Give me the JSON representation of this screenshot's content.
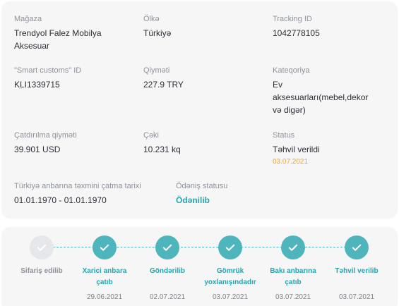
{
  "details": {
    "store": {
      "label": "Mağaza",
      "value": "Trendyol Falez Mobilya Aksesuar"
    },
    "country": {
      "label": "Ölkə",
      "value": "Türkiyə"
    },
    "tracking": {
      "label": "Tracking ID",
      "value": "1042778105"
    },
    "smart_customs": {
      "label": "\"Smart customs\" ID",
      "value": "KLI1339715"
    },
    "price": {
      "label": "Qiyməti",
      "value": "227.9 TRY"
    },
    "category": {
      "label": "Kateqoriya",
      "value_lines": [
        "Ev",
        "aksesuarları(mebel,dekor",
        "və digər)"
      ]
    },
    "delivery_price": {
      "label": "Çatdırılma qiyməti",
      "value": "39.901 USD"
    },
    "weight": {
      "label": "Çəki",
      "value": "10.231 kq"
    },
    "status": {
      "label": "Status",
      "value": "Təhvil verildi",
      "date": "03.07.2021"
    },
    "eta": {
      "label": "Türkiyə anbarına təxmini çatma tarixi",
      "value": "01.01.1970 - 01.01.1970"
    },
    "payment": {
      "label": "Ödəniş statusu",
      "value": "Ödənilib"
    }
  },
  "colors": {
    "accent": "#4fb5bd",
    "accent_text": "#2aa3ad",
    "status_date": "#e8a33a",
    "pending": "#e6e7ea"
  },
  "stepper": [
    {
      "lines": [
        "Sifariş edilib"
      ],
      "date": "",
      "done": false
    },
    {
      "lines": [
        "Xarici anbara",
        "çatıb"
      ],
      "date": "29.06.2021",
      "done": true
    },
    {
      "lines": [
        "Göndərilib"
      ],
      "date": "02.07.2021",
      "done": true
    },
    {
      "lines": [
        "Gömrük",
        "yoxlanışındadır"
      ],
      "date": "03.07.2021",
      "done": true
    },
    {
      "lines": [
        "Bakı anbarına",
        "çatıb"
      ],
      "date": "03.07.2021",
      "done": true
    },
    {
      "lines": [
        "Təhvil verilib"
      ],
      "date": "03.07.2021",
      "done": true
    }
  ]
}
